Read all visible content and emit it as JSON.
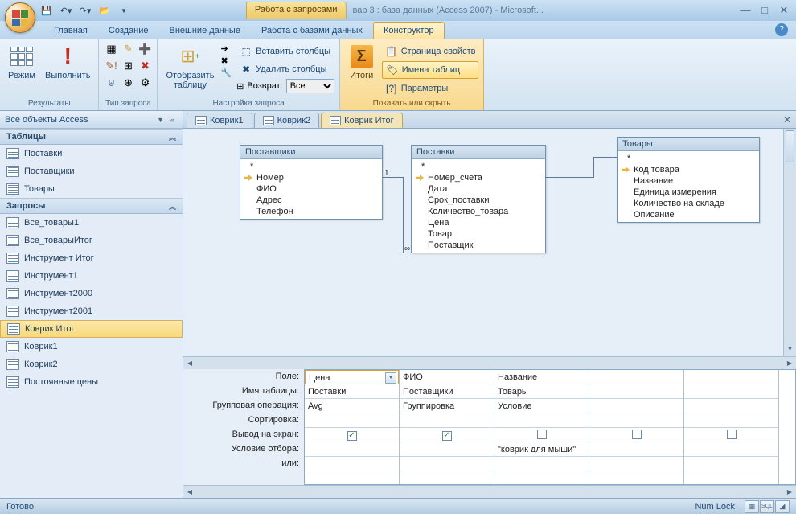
{
  "title": {
    "context_tab": "Работа с запросами",
    "app": "вар 3 : база данных (Access 2007) - Microsoft..."
  },
  "tabs": {
    "home": "Главная",
    "create": "Создание",
    "external": "Внешние данные",
    "dbtools": "Работа с базами данных",
    "design": "Конструктор"
  },
  "ribbon": {
    "results": {
      "view": "Режим",
      "run": "Выполнить",
      "label": "Результаты"
    },
    "qtype": {
      "label": "Тип запроса"
    },
    "setup": {
      "showtable": "Отобразить\nтаблицу",
      "insertcols": "Вставить столбцы",
      "deletecols": "Удалить столбцы",
      "return": "Возврат:",
      "return_val": "Все",
      "label": "Настройка запроса"
    },
    "showhide": {
      "totals": "Итоги",
      "propsheet": "Страница свойств",
      "tablenames": "Имена таблиц",
      "params": "Параметры",
      "label": "Показать или скрыть"
    }
  },
  "nav": {
    "title": "Все объекты Access",
    "group_tables": "Таблицы",
    "tables": [
      "Поставки",
      "Поставщики",
      "Товары"
    ],
    "group_queries": "Запросы",
    "queries": [
      "Все_товары1",
      "Все_товарыИтог",
      "Инструмент Итог",
      "Инструмент1",
      "Инструмент2000",
      "Инструмент2001",
      "Коврик Итог",
      "Коврик1",
      "Коврик2",
      "Постоянные цены"
    ],
    "selected_query": "Коврик Итог"
  },
  "doctabs": [
    "Коврик1",
    "Коврик2",
    "Коврик Итог"
  ],
  "doctab_active": 2,
  "tables_on_canvas": {
    "t1": {
      "name": "Поставщики",
      "fields_star": "*",
      "key": "Номер",
      "fields": [
        "ФИО",
        "Адрес",
        "Телефон"
      ]
    },
    "t2": {
      "name": "Поставки",
      "fields_star": "*",
      "key": "Номер_счета",
      "fields": [
        "Дата",
        "Срок_поставки",
        "Количество_товара",
        "Цена",
        "Товар",
        "Поставщик"
      ]
    },
    "t3": {
      "name": "Товары",
      "fields_star": "*",
      "key": "Код товара",
      "fields": [
        "Название",
        "Единица измерения",
        "Количество на складе",
        "Описание"
      ]
    }
  },
  "grid": {
    "labels": {
      "field": "Поле:",
      "table": "Имя таблицы:",
      "total": "Групповая операция:",
      "sort": "Сортировка:",
      "show": "Вывод на экран:",
      "criteria": "Условие отбора:",
      "or": "или:"
    },
    "cols": [
      {
        "field": "Цена",
        "table": "Поставки",
        "total": "Avg",
        "show": true,
        "criteria": ""
      },
      {
        "field": "ФИО",
        "table": "Поставщики",
        "total": "Группировка",
        "show": true,
        "criteria": ""
      },
      {
        "field": "Название",
        "table": "Товары",
        "total": "Условие",
        "show": false,
        "criteria": "\"коврик для мыши\""
      },
      {
        "field": "",
        "table": "",
        "total": "",
        "show": false,
        "criteria": ""
      },
      {
        "field": "",
        "table": "",
        "total": "",
        "show": false,
        "criteria": ""
      }
    ]
  },
  "status": {
    "ready": "Готово",
    "numlock": "Num Lock"
  }
}
